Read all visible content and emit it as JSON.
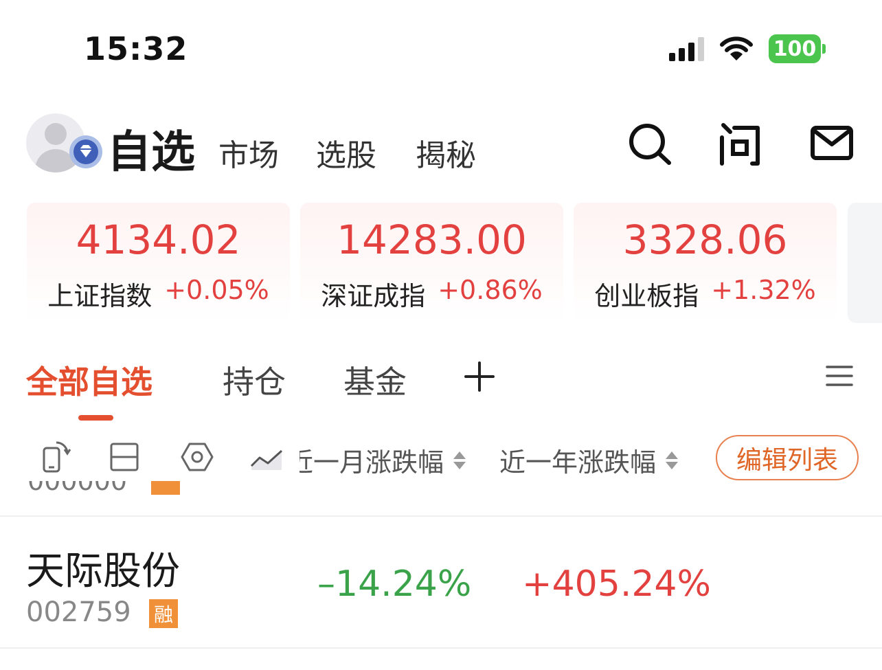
{
  "status_bar": {
    "time": "15:32",
    "battery": "100"
  },
  "header": {
    "title": "自选",
    "tabs": [
      "市场",
      "选股",
      "揭秘"
    ]
  },
  "indices": [
    {
      "value": "4134.02",
      "name": "上证指数",
      "change": "+0.05%"
    },
    {
      "value": "14283.00",
      "name": "深证成指",
      "change": "+0.86%"
    },
    {
      "value": "3328.06",
      "name": "创业板指",
      "change": "+1.32%"
    }
  ],
  "watchlist_tabs": [
    "全部自选",
    "持仓",
    "基金"
  ],
  "toolbar": {
    "column_month": "近一月涨跌幅",
    "column_year": "近一年涨跌幅",
    "edit_label": "编辑列表"
  },
  "stocks": [
    {
      "name": "天际股份",
      "code": "002759",
      "tag": "融",
      "month_change": "–14.24%",
      "year_change": "+405.24%"
    }
  ],
  "colors": {
    "accent": "#e44f2f",
    "up": "#e2413f",
    "down": "#3aa34a",
    "tag": "#f0913a"
  }
}
